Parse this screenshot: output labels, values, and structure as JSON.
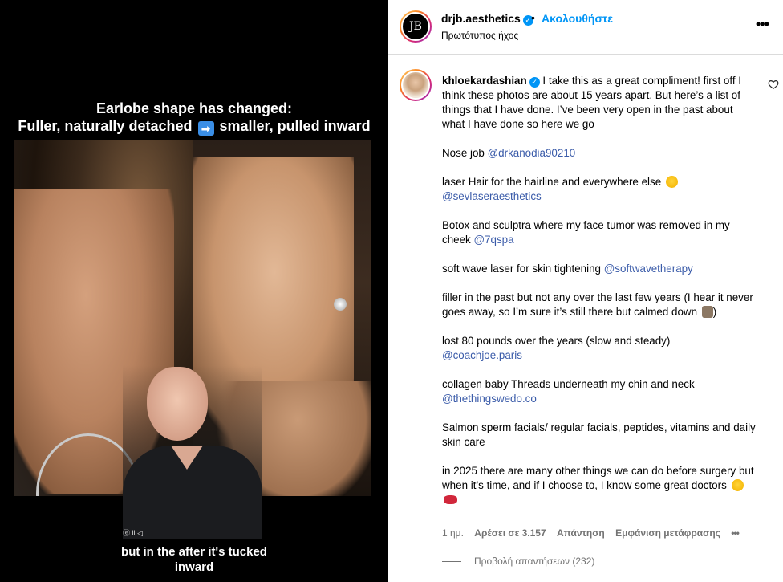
{
  "video": {
    "caption_top_1": "Earlobe shape has changed:",
    "caption_top_2a": "Fuller, naturally detached",
    "caption_top_arrow": "➡",
    "caption_top_2b": "smaller, pulled inward",
    "watermark": "ⓔ.ll ◁",
    "caption_bottom_1": "but in the after it's tucked",
    "caption_bottom_2": "inward"
  },
  "header": {
    "avatar_text": "JB",
    "username": "drjb.aesthetics",
    "verified_mark": "✓",
    "dot": "•",
    "follow_label": "Ακολουθήστε",
    "audio_label": "Πρωτότυπος ήχος",
    "more_icon": "more-horizontal-icon"
  },
  "comment": {
    "username": "khloekardashian",
    "verified_mark": "✓",
    "intro": " I take this as a great compliment! first off I think these photos are about 15 years apart, But here’s a list of things that I have done. I’ve been very open in the past about what I have done so here we go",
    "nose_text": "Nose job ",
    "nose_mention": "@drkanodia90210",
    "laser_text": "laser Hair for the hairline and everywhere else ",
    "laser_mention": "@sevlaseraesthetics",
    "botox_text": "Botox and sculptra where my face tumor was removed in my cheek ",
    "botox_mention": "@7qspa",
    "softwave_text": "soft wave laser for skin tightening ",
    "softwave_mention": "@softwavetherapy",
    "filler_text": "filler in the past but not any over the last few years (I hear it never goes away, so I’m sure it’s still there but calmed down ",
    "filler_end": ")",
    "lost_text": "lost 80 pounds over the years (slow and steady)",
    "lost_mention": "@coachjoe.paris",
    "collagen_text": "collagen baby Threads underneath my chin and neck",
    "collagen_mention": "@thethingswedo.co",
    "salmon_text": "Salmon sperm facials/ regular facials, peptides, vitamins and daily skin care",
    "closing_text": "in 2025 there are many other things we can do before surgery but when it’s time, and if I choose to, I know some great doctors ",
    "age": "1 ημ.",
    "likes": "Αρέσει σε 3.157",
    "reply_label": "Απάντηση",
    "translate_label": "Εμφάνιση μετάφρασης",
    "more_dots": "•••",
    "view_replies": "Προβολή απαντήσεων (232)",
    "like_icon": "heart-outline-icon"
  }
}
